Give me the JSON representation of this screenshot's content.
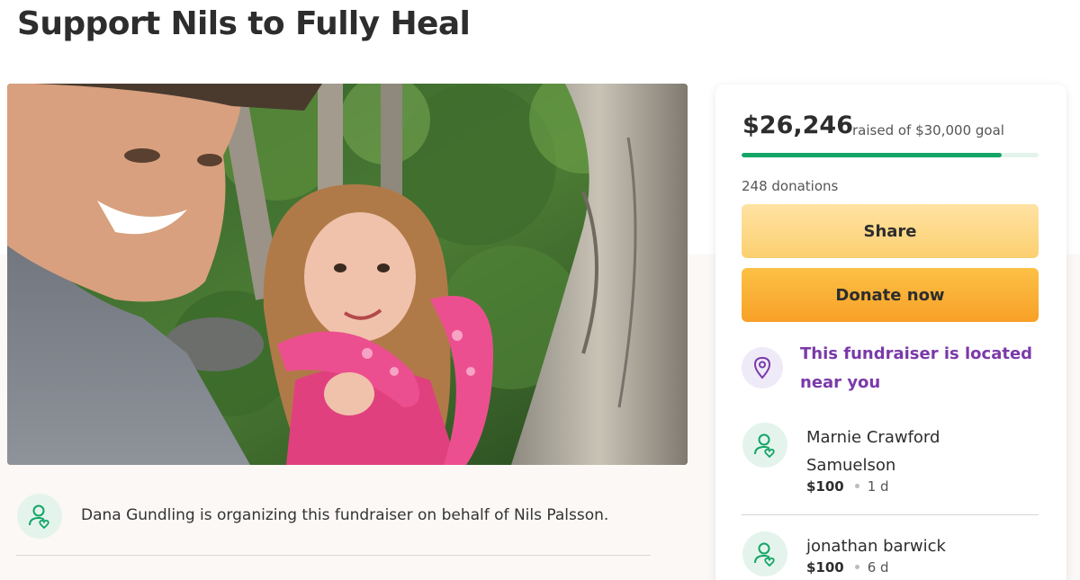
{
  "page": {
    "title": "Support Nils to Fully Heal"
  },
  "organizer": {
    "text": "Dana Gundling is organizing this fundraiser on behalf of Nils Palsson.",
    "icon": "user-heart-icon"
  },
  "donation_card": {
    "amount_raised": "$26,246",
    "goal_text": "raised of $30,000 goal",
    "progress_fraction": 0.875,
    "donations_count": "248 donations",
    "share_label": "Share",
    "donate_label": "Donate now",
    "location_text": "This fundraiser is located near you",
    "location_icon": "location-pin-icon"
  },
  "donors": [
    {
      "name": "Marnie Crawford Samuelson",
      "amount": "$100",
      "time": "1 d",
      "icon": "user-heart-icon"
    },
    {
      "name": "jonathan barwick",
      "amount": "$100",
      "time": "6 d",
      "icon": "user-heart-icon"
    }
  ],
  "colors": {
    "accent_green": "#13a566",
    "share_button": "#fbcf6f",
    "donate_button": "#f8a027",
    "location_purple": "#7a3aa9",
    "icon_bg_green": "#e4f4ec"
  }
}
